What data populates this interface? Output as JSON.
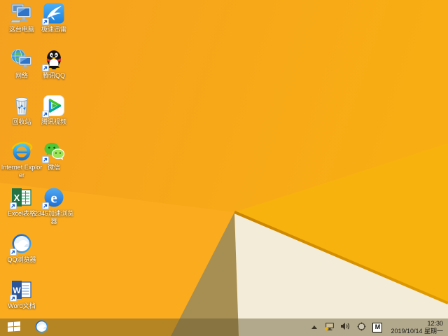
{
  "desktop": {
    "icons": [
      {
        "label": "这台电脑",
        "name": "this-pc",
        "shortcut": false
      },
      {
        "label": "极速迅雷",
        "name": "xunlei",
        "shortcut": true
      },
      {
        "label": "网络",
        "name": "network",
        "shortcut": false
      },
      {
        "label": "腾讯QQ",
        "name": "tencent-qq",
        "shortcut": true
      },
      {
        "label": "回收站",
        "name": "recycle-bin",
        "shortcut": false
      },
      {
        "label": "腾讯视频",
        "name": "tencent-video",
        "shortcut": true
      },
      {
        "label": "Internet Explorer",
        "name": "internet-explorer",
        "shortcut": false
      },
      {
        "label": "微信",
        "name": "wechat",
        "shortcut": true
      },
      {
        "label": "Excel表格",
        "name": "excel",
        "shortcut": true
      },
      {
        "label": "2345加速浏览器",
        "name": "2345-browser",
        "shortcut": true
      },
      {
        "label": "QQ浏览器",
        "name": "qq-browser",
        "shortcut": true
      },
      {
        "label": "Word文档",
        "name": "word",
        "shortcut": true
      }
    ]
  },
  "taskbar": {
    "tray": {
      "ime": "M",
      "time": "12:30",
      "date": "2019/10/14 星期一"
    }
  },
  "colors": {
    "wallpaper_base": "#F6A41D",
    "wallpaper_bright": "#F8B20D",
    "wallpaper_light": "#FAAB1E",
    "facet_tan": "#A78E52",
    "facet_cream": "#F3ECD8",
    "facet_edge": "#D28E00",
    "taskbar_tint": "rgba(96,84,44,0.44)",
    "label_text": "#FFFFFF",
    "clock_text": "#181818"
  }
}
